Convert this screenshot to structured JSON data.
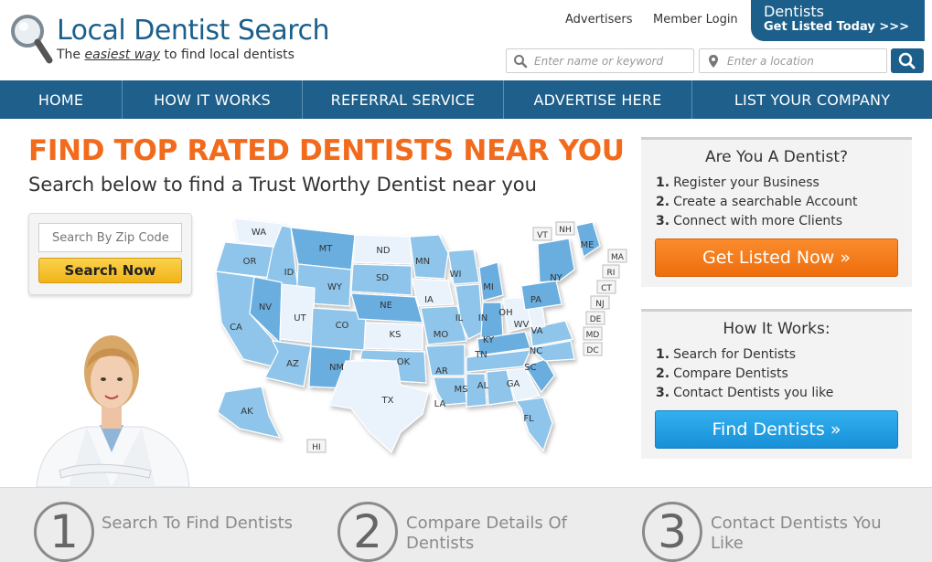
{
  "header": {
    "logo_title": "Local Dentist Search",
    "tagline_before": "The",
    "tagline_emphasis": "easiest way",
    "tagline_after": "to find local dentists",
    "links": {
      "advertisers": "Advertisers",
      "member_login": "Member Login"
    },
    "cta_line1": "Dentists",
    "cta_line2": "Get Listed Today >>>",
    "search_keyword_placeholder": "Enter name or keyword",
    "search_location_placeholder": "Enter a location",
    "brand_color": "#1c5f8a"
  },
  "nav": {
    "items": [
      {
        "label": "HOME"
      },
      {
        "label": "HOW IT WORKS"
      },
      {
        "label": "REFERRAL SERVICE"
      },
      {
        "label": "ADVERTISE HERE"
      },
      {
        "label": "LIST YOUR COMPANY"
      }
    ]
  },
  "main": {
    "title": "FIND TOP RATED DENTISTS NEAR YOU",
    "subtitle": "Search below to find a Trust Worthy Dentist near you",
    "zip_placeholder": "Search By Zip Code",
    "search_button": "Search Now",
    "accent_color": "#f26a1b"
  },
  "map": {
    "states": [
      "WA",
      "OR",
      "CA",
      "ID",
      "NV",
      "MT",
      "WY",
      "UT",
      "AZ",
      "CO",
      "NM",
      "ND",
      "SD",
      "NE",
      "KS",
      "OK",
      "TX",
      "MN",
      "IA",
      "MO",
      "AR",
      "LA",
      "WI",
      "IL",
      "MI",
      "IN",
      "OH",
      "KY",
      "TN",
      "MS",
      "AL",
      "GA",
      "FL",
      "SC",
      "NC",
      "VA",
      "WV",
      "PA",
      "NY",
      "ME",
      "AK"
    ],
    "tag_states": [
      "VT",
      "NH",
      "MA",
      "RI",
      "CT",
      "NJ",
      "DE",
      "MD",
      "DC",
      "HI"
    ]
  },
  "sidebar": {
    "dentist_box": {
      "title": "Are You A Dentist?",
      "items": [
        {
          "num": "1.",
          "text": "Register your Business"
        },
        {
          "num": "2.",
          "text": "Create a searchable Account"
        },
        {
          "num": "3.",
          "text": "Connect with more Clients"
        }
      ],
      "button": "Get Listed Now »"
    },
    "how_box": {
      "title": "How It Works:",
      "items": [
        {
          "num": "1.",
          "text": "Search for Dentists"
        },
        {
          "num": "2.",
          "text": "Compare Dentists"
        },
        {
          "num": "3.",
          "text": "Contact Dentists you like"
        }
      ],
      "button": "Find Dentists »"
    }
  },
  "steps": [
    {
      "num": "1",
      "line1": "Search To Find Dentists",
      "line2": ""
    },
    {
      "num": "2",
      "line1": "Compare Details Of",
      "line2": "Dentists"
    },
    {
      "num": "3",
      "line1": "Contact Dentists You",
      "line2": "Like"
    }
  ]
}
